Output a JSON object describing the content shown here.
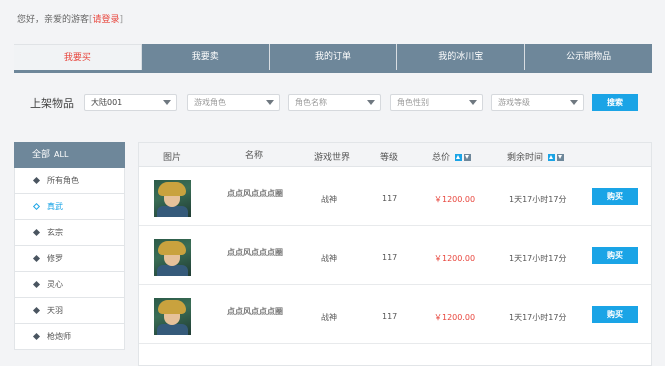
{
  "header": {
    "greeting": "您好，亲爱的游客",
    "login_link": "请登录",
    "bracket_open": "[",
    "bracket_close": "]"
  },
  "tabs": [
    {
      "label": "我要买",
      "active": true
    },
    {
      "label": "我要卖",
      "active": false
    },
    {
      "label": "我的订单",
      "active": false
    },
    {
      "label": "我的冰川宝",
      "active": false
    },
    {
      "label": "公示期物品",
      "active": false
    }
  ],
  "filter": {
    "label": "上架物品",
    "selects": [
      {
        "value": "大陆001",
        "placeholder": ""
      },
      {
        "value": "",
        "placeholder": "游戏角色"
      },
      {
        "value": "",
        "placeholder": "角色名称"
      },
      {
        "value": "",
        "placeholder": "角色性别"
      },
      {
        "value": "",
        "placeholder": "游戏等级"
      }
    ],
    "search_label": "搜索"
  },
  "sidebar": {
    "title": "全部",
    "title_en": "ALL",
    "items": [
      {
        "label": "所有角色",
        "active": false
      },
      {
        "label": "真武",
        "active": true
      },
      {
        "label": "玄宗",
        "active": false
      },
      {
        "label": "修罗",
        "active": false
      },
      {
        "label": "灵心",
        "active": false
      },
      {
        "label": "天羽",
        "active": false
      },
      {
        "label": "枪炮师",
        "active": false
      }
    ]
  },
  "table": {
    "headers": {
      "image": "图片",
      "name": "名称",
      "world": "游戏世界",
      "level": "等级",
      "price": "总价",
      "time": "剩余时间"
    },
    "rows": [
      {
        "name": "点点风点点点圈",
        "world": "战神",
        "level": "117",
        "price": "￥1200.00",
        "time": "1天17小时17分",
        "buy_label": "购买"
      },
      {
        "name": "点点风点点点圈",
        "world": "战神",
        "level": "117",
        "price": "￥1200.00",
        "time": "1天17小时17分",
        "buy_label": "购买"
      },
      {
        "name": "点点风点点点圈",
        "world": "战神",
        "level": "117",
        "price": "￥1200.00",
        "time": "1天17小时17分",
        "buy_label": "购买"
      }
    ]
  },
  "colors": {
    "tab_bg": "#6e879a",
    "accent_blue": "#1aa4e6",
    "price_red": "#e8453c"
  }
}
